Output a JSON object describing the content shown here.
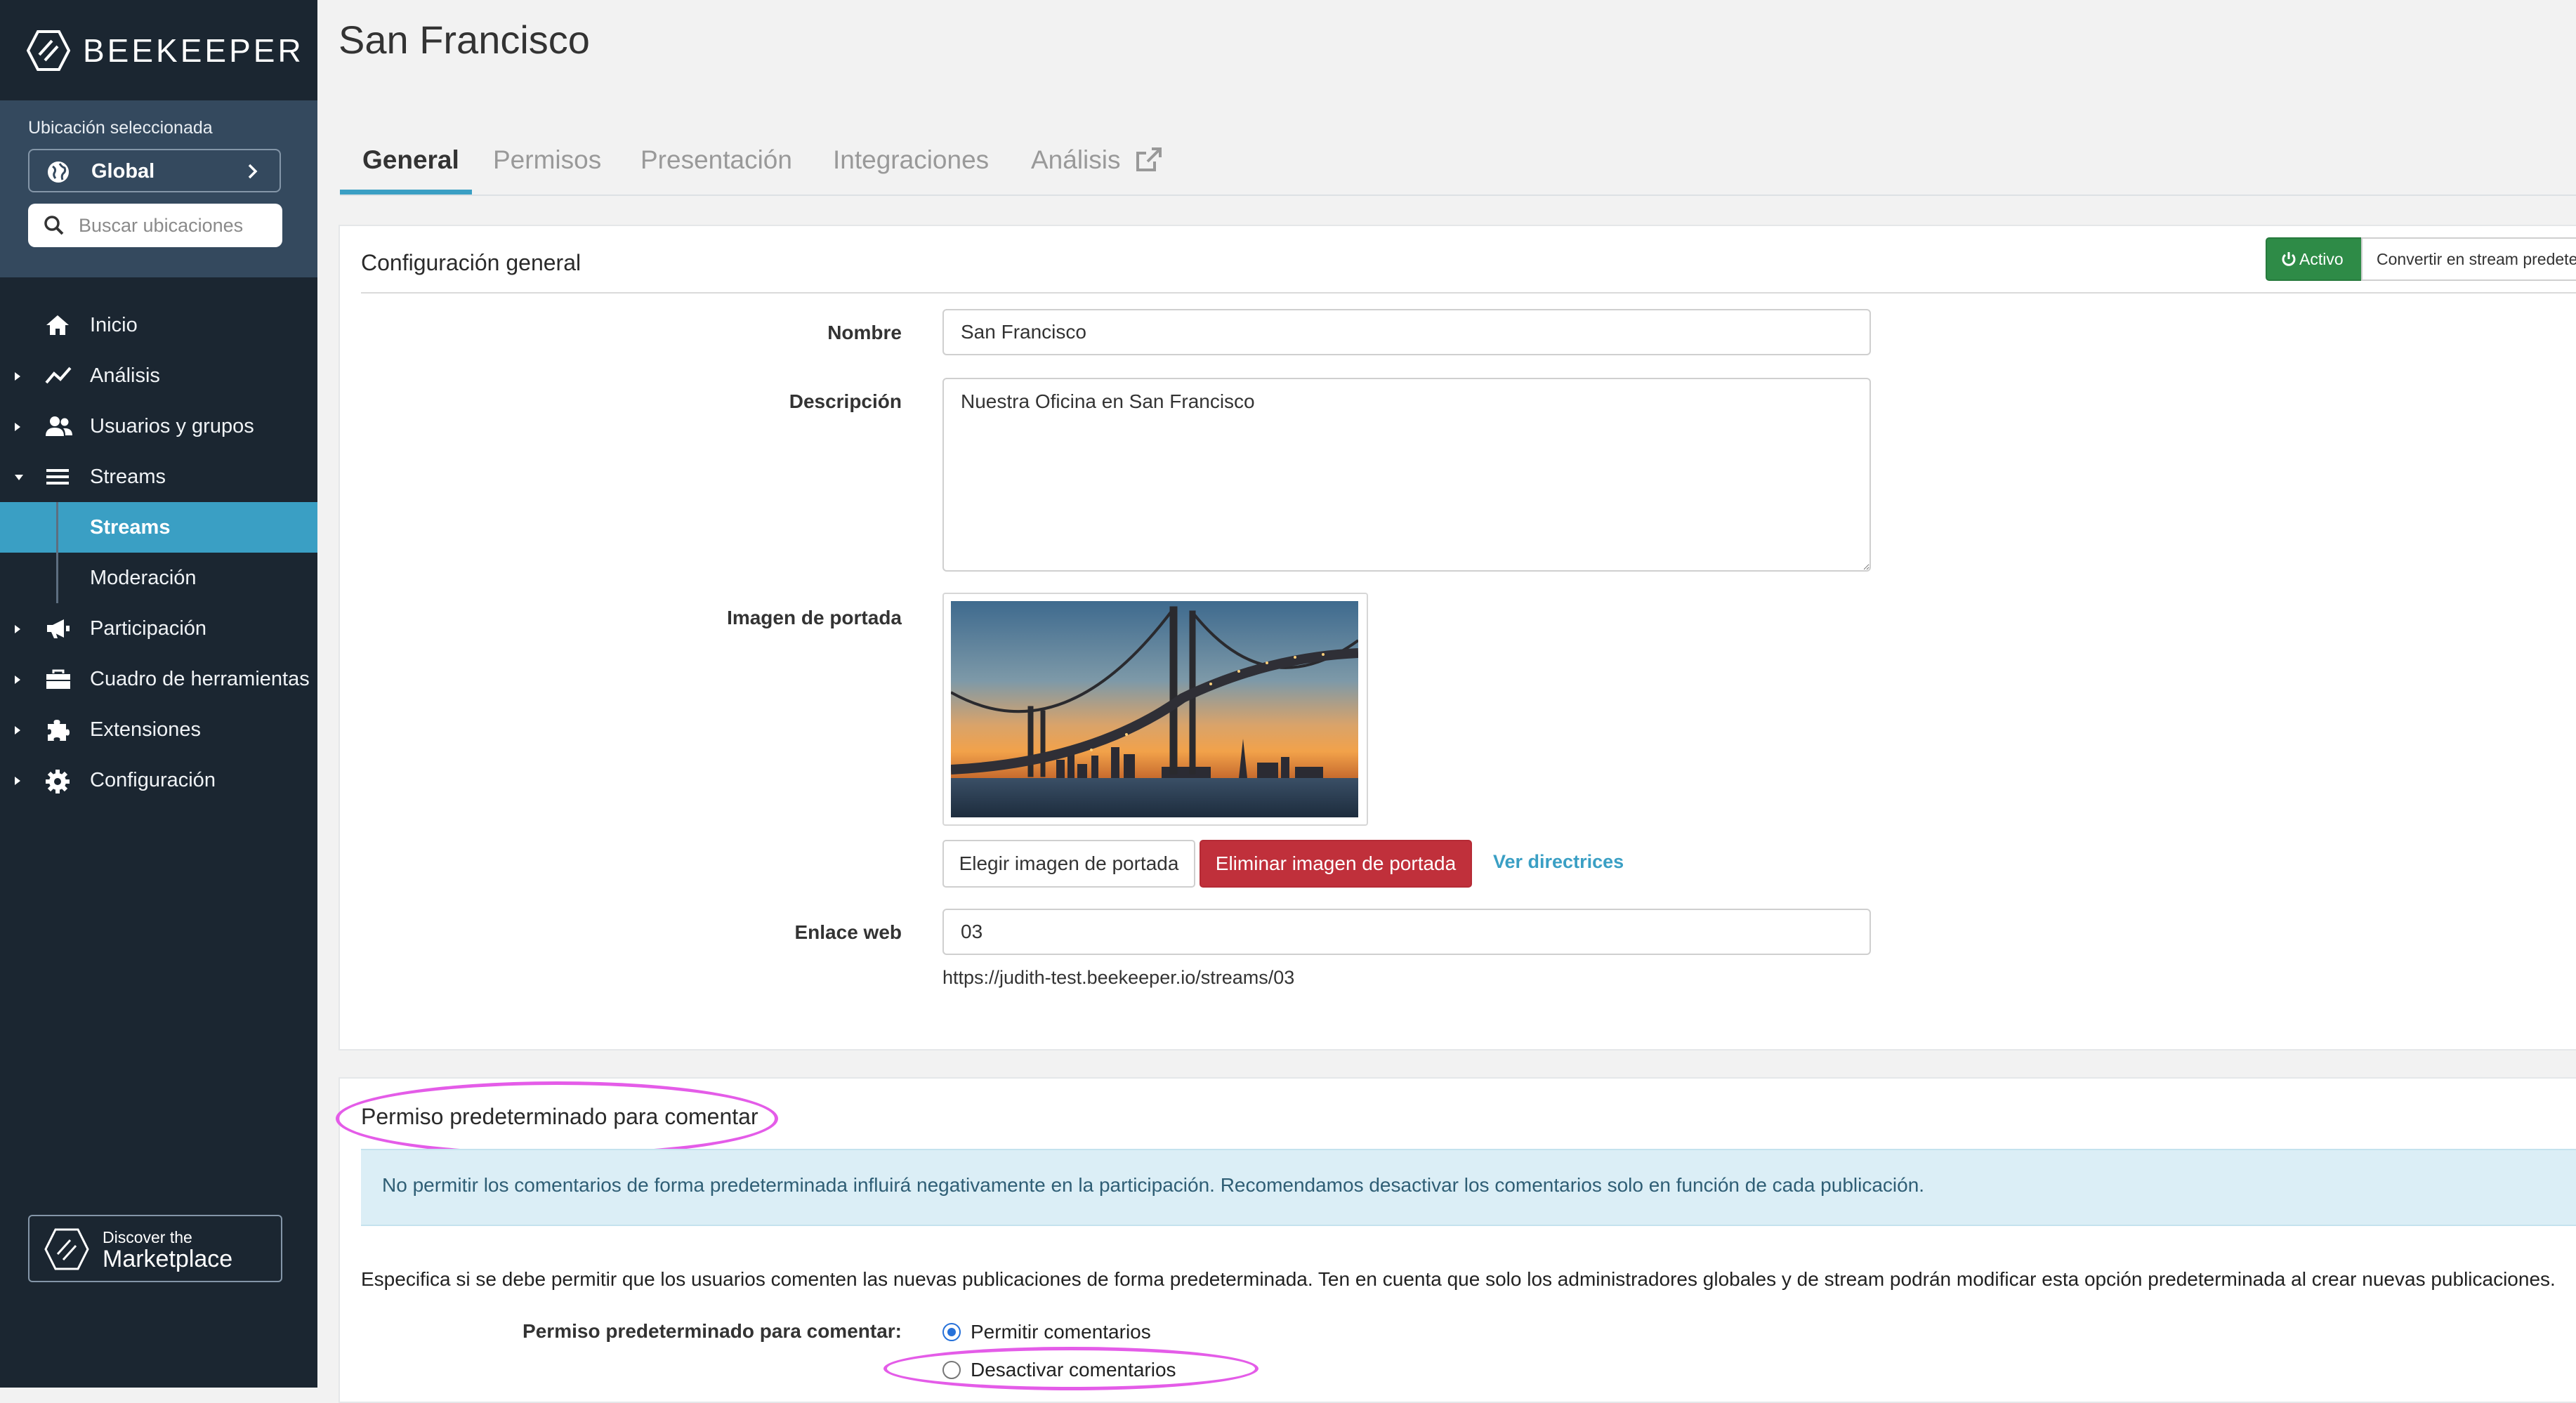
{
  "brand": {
    "name": "BEEKEEPER"
  },
  "location": {
    "label": "Ubicación seleccionada",
    "selected": "Global",
    "search_placeholder": "Buscar ubicaciones"
  },
  "nav": {
    "items": [
      {
        "label": "Inicio",
        "icon": "home-icon"
      },
      {
        "label": "Análisis",
        "icon": "chart-line-icon"
      },
      {
        "label": "Usuarios y grupos",
        "icon": "users-icon"
      },
      {
        "label": "Streams",
        "icon": "list-icon"
      },
      {
        "label": "Participación",
        "icon": "megaphone-icon"
      },
      {
        "label": "Cuadro de herramientas",
        "icon": "toolbox-icon"
      },
      {
        "label": "Extensiones",
        "icon": "puzzle-icon"
      },
      {
        "label": "Configuración",
        "icon": "gear-icon"
      }
    ],
    "subitems": [
      {
        "label": "Streams",
        "active": true
      },
      {
        "label": "Moderación",
        "active": false
      }
    ]
  },
  "marketplace": {
    "line1": "Discover the",
    "line2": "Marketplace"
  },
  "page": {
    "title": "San Francisco"
  },
  "tabs": [
    {
      "label": "General",
      "active": true
    },
    {
      "label": "Permisos"
    },
    {
      "label": "Presentación"
    },
    {
      "label": "Integraciones"
    },
    {
      "label": "Análisis",
      "icon": "external-link-icon"
    }
  ],
  "general": {
    "title": "Configuración general",
    "status_button": "Activo",
    "convert_button": "Convertir en stream predeterminado",
    "name_label": "Nombre",
    "name_value": "San Francisco",
    "description_label": "Descripción",
    "description_value": "Nuestra Oficina en San Francisco",
    "cover_label": "Imagen de portada",
    "choose_cover": "Elegir imagen de portada",
    "remove_cover": "Eliminar imagen de portada",
    "guidelines_link": "Ver directrices",
    "weblink_label": "Enlace web",
    "weblink_value": "03",
    "weblink_url": "https://judith-test.beekeeper.io/streams/03"
  },
  "comments": {
    "title": "Permiso predeterminado para comentar",
    "alert": "No permitir los comentarios de forma predeterminada influirá negativamente en la participación. Recomendamos desactivar los comentarios solo en función de cada publicación.",
    "description": "Especifica si se debe permitir que los usuarios comenten las nuevas publicaciones de forma predeterminada. Ten en cuenta que solo los administradores globales y de stream podrán modificar esta opción predeterminada al crear nuevas publicaciones.",
    "field_label": "Permiso predeterminado para comentar:",
    "option_allow": "Permitir comentarios",
    "option_disable": "Desactivar comentarios",
    "selected": "Permitir comentarios"
  },
  "colors": {
    "sidebar": "#1b2631",
    "location_panel": "#34495e",
    "accent": "#3a9fc4",
    "danger": "#c0303b",
    "success": "#2e8b47",
    "highlight": "#e45ce8"
  }
}
